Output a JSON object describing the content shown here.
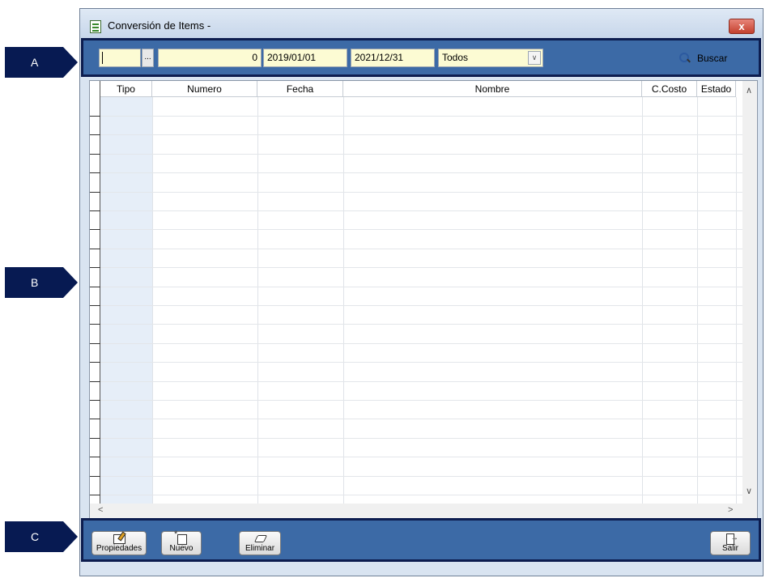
{
  "callouts": {
    "a": "A",
    "b": "B",
    "c": "C"
  },
  "window": {
    "title": "Conversión de Items -",
    "close_label": "x"
  },
  "filter": {
    "code_value": "",
    "ellipsis_label": "...",
    "numero_value": "0",
    "fecha_desde": "2019/01/01",
    "fecha_hasta": "2021/12/31",
    "estado_selected": "Todos",
    "buscar_label": "Buscar"
  },
  "grid": {
    "columns": [
      "Tipo",
      "Numero",
      "Fecha",
      "Nombre",
      "C.Costo",
      "Estado"
    ],
    "rows": []
  },
  "toolbar": {
    "propiedades_label": "Propiedades",
    "nuevo_label": "Nuevo",
    "eliminar_label": "Eliminar",
    "salir_label": "Salir"
  },
  "icons": {
    "app": "document-list-icon",
    "buscar": "search-icon",
    "propiedades": "edit-properties-icon",
    "nuevo": "new-document-icon",
    "eliminar": "eraser-icon",
    "salir": "exit-door-icon"
  },
  "colors": {
    "panel": "#3c6aa6",
    "panel_border": "#0d1d4f",
    "input_bg": "#fcfbd3",
    "callout": "#071a52"
  }
}
